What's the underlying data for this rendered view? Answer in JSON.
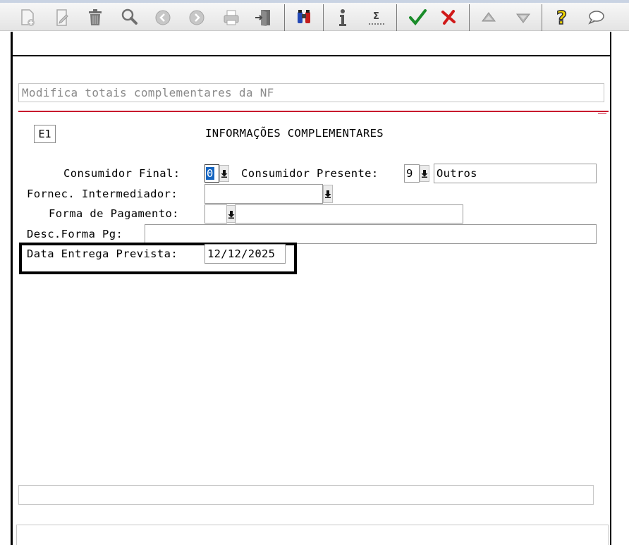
{
  "toolbar": {
    "buttons": [
      {
        "icon": "new-document-icon"
      },
      {
        "icon": "edit-icon"
      },
      {
        "icon": "delete-trash-icon"
      },
      {
        "icon": "search-magnifier-icon"
      },
      {
        "icon": "previous-record-icon"
      },
      {
        "icon": "next-record-icon"
      },
      {
        "icon": "print-icon"
      },
      {
        "icon": "exit-door-icon"
      },
      {
        "icon": "binoculars-icon"
      },
      {
        "icon": "info-icon"
      },
      {
        "icon": "sum-total-icon"
      },
      {
        "icon": "confirm-check-icon"
      },
      {
        "icon": "cancel-x-icon"
      },
      {
        "icon": "move-up-icon"
      },
      {
        "icon": "move-down-icon"
      },
      {
        "icon": "help-question-icon"
      },
      {
        "icon": "chat-bubble-icon"
      }
    ],
    "colors": {
      "confirm": "#1a8c2a",
      "cancel": "#d01919",
      "help": "#e6c800"
    }
  },
  "form": {
    "title": "Modifica totais complementares da NF",
    "code": "E1",
    "heading": "INFORMAÇÕES COMPLEMENTARES",
    "consumidor_final_label": "Consumidor Final:",
    "consumidor_final_value": "0",
    "consumidor_presente_label": "Consumidor Presente:",
    "consumidor_presente_value": "9",
    "consumidor_presente_desc": "Outros",
    "fornec_label": "Fornec. Intermediador:",
    "fornec_value": "",
    "forma_pag_label": "Forma de Pagamento:",
    "forma_pag_value": "",
    "forma_pag_desc": "",
    "desc_forma_label": "Desc.Forma Pg:",
    "desc_forma_value": "",
    "data_entrega_label": "Data Entrega Prevista:",
    "data_entrega_value": "12/12/2025"
  },
  "accent": {
    "red_line": "#c8102e",
    "selection": "#1565c0"
  }
}
